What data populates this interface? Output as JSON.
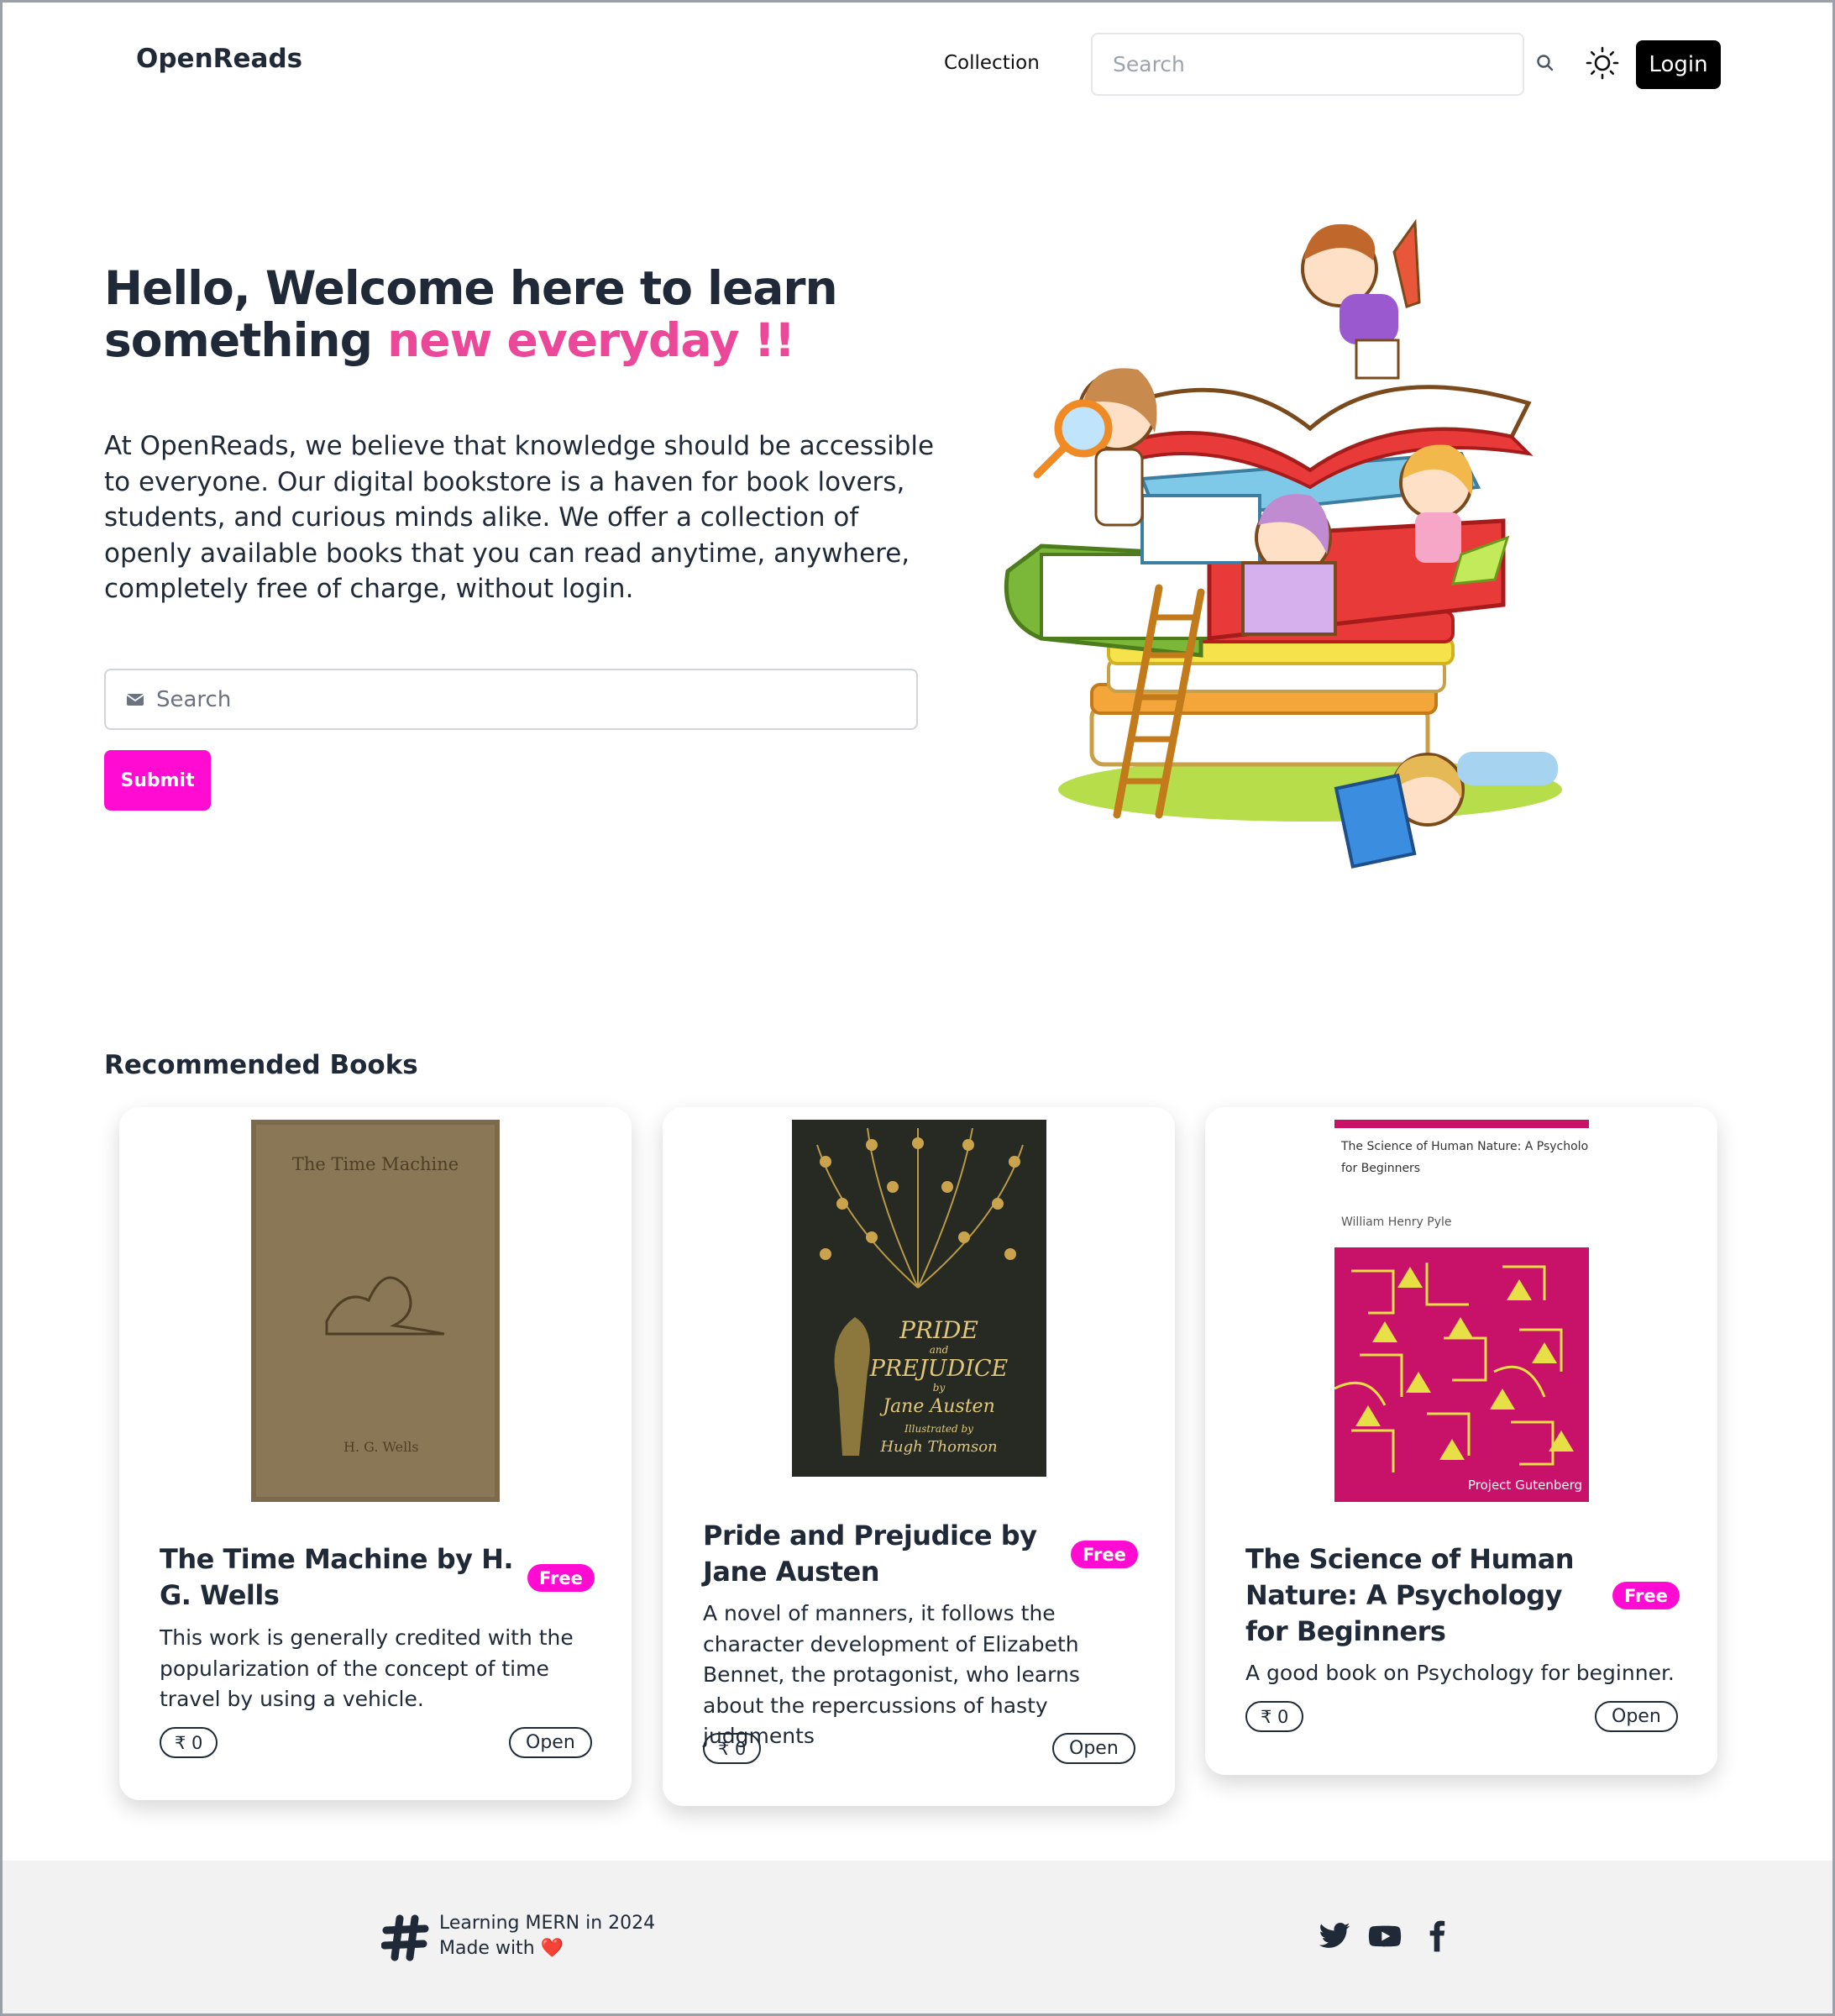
{
  "header": {
    "logo": "OpenReads",
    "nav_collection": "Collection",
    "search_placeholder": "Search",
    "login_label": "Login"
  },
  "hero": {
    "title_main": "Hello, Welcome here to learn something ",
    "title_accent": "new everyday !!",
    "description": "At OpenReads, we believe that knowledge should be accessible to everyone. Our digital bookstore is a haven for book lovers, students, and curious minds alike. We offer a collection of openly available books that you can read anytime, anywhere, completely free of charge, without login.",
    "search_placeholder": "Search",
    "submit_label": "Submit"
  },
  "recommended": {
    "title": "Recommended Books",
    "books": [
      {
        "title": "The Time Machine by H. G. Wells",
        "badge": "Free",
        "description": "This work is generally credited with the popularization of the concept of time travel by using a vehicle.",
        "price": "₹ 0",
        "open_label": "Open",
        "cover_title": "The Time Machine",
        "cover_author": "H. G. Wells"
      },
      {
        "title": "Pride and Prejudice by Jane Austen",
        "badge": "Free",
        "description": "A novel of manners, it follows the character development of Elizabeth Bennet, the protagonist, who learns about the repercussions of hasty judgments",
        "price": "₹ 0",
        "open_label": "Open",
        "cover_line1": "PRIDE",
        "cover_line2": "and",
        "cover_line3": "PREJUDICE",
        "cover_line4": "by",
        "cover_line5": "Jane Austen",
        "cover_line6": "Illustrated by",
        "cover_line7": "Hugh Thomson"
      },
      {
        "title": "The Science of Human Nature: A Psychology for Beginners",
        "badge": "Free",
        "description": "A good book on Psychology for beginner.",
        "price": "₹ 0",
        "open_label": "Open",
        "cover_title_1": "The Science of Human Nature: A Psychology",
        "cover_title_2": "for Beginners",
        "cover_author": "William Henry Pyle",
        "cover_publisher": "Project Gutenberg"
      }
    ]
  },
  "carousel": {
    "active_index": 0,
    "count": 2
  },
  "footer": {
    "line1": "Learning MERN in 2024",
    "line2": "Made with",
    "heart": "❤️",
    "social": [
      "twitter-icon",
      "youtube-icon",
      "facebook-icon"
    ]
  },
  "colors": {
    "accent_pink": "#ec4899",
    "button_magenta": "#ff0bd1",
    "text_dark": "#1f2937",
    "footer_bg": "#f2f2f2"
  }
}
